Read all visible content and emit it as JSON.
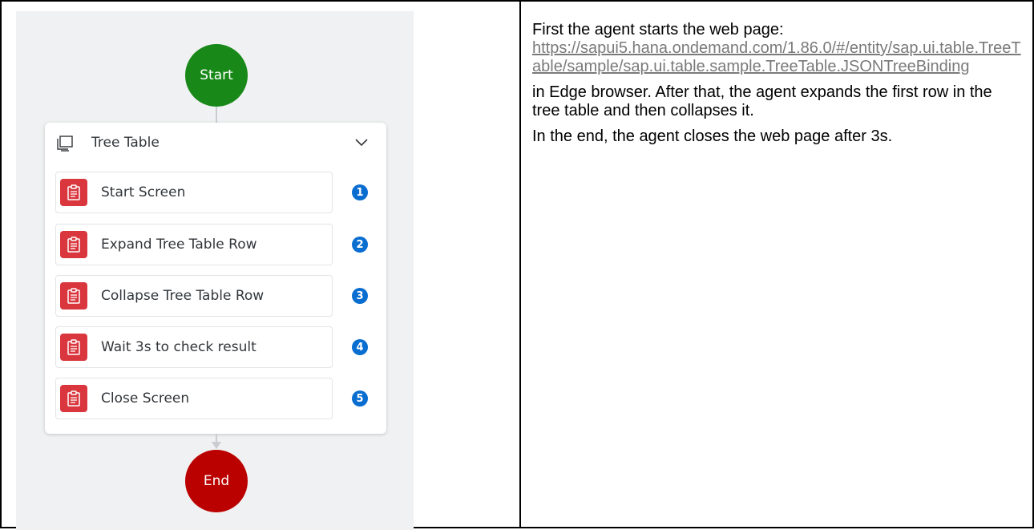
{
  "workflow": {
    "start_label": "Start",
    "end_label": "End",
    "group": {
      "title": "Tree Table",
      "steps": [
        {
          "label": "Start Screen",
          "number": "1"
        },
        {
          "label": "Expand Tree Table Row",
          "number": "2"
        },
        {
          "label": "Collapse Tree Table Row",
          "number": "3"
        },
        {
          "label": "Wait 3s to check result",
          "number": "4"
        },
        {
          "label": "Close Screen",
          "number": "5"
        }
      ]
    }
  },
  "description": {
    "intro": "First the agent starts the web page:",
    "url": "https://sapui5.hana.ondemand.com/1.86.0/#/entity/sap.ui.table.TreeTable/sample/sap.ui.table.sample.TreeTable.JSONTreeBinding",
    "paragraph2": "in Edge browser. After that, the agent expands the first row in the tree table and then collapses it.",
    "paragraph3": "In the end, the agent closes the web page after 3s."
  },
  "colors": {
    "start_node": "#188918",
    "end_node": "#bb0000",
    "step_icon": "#d9363e",
    "badge": "#0a6ed1"
  },
  "icons": {
    "group": "screen-icon",
    "step": "clipboard-icon",
    "toggle": "chevron-down-icon"
  }
}
